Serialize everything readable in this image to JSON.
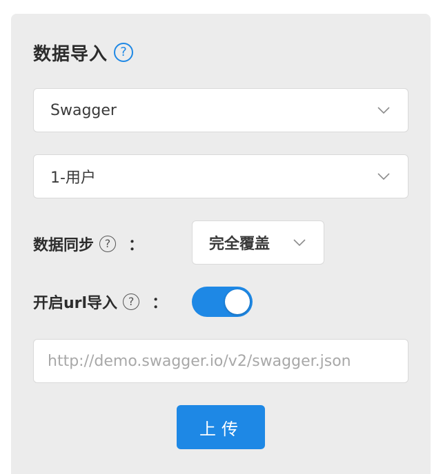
{
  "import": {
    "title": "数据导入",
    "title_help_icon": "question-circle-icon",
    "source_select": {
      "value": "Swagger"
    },
    "project_select": {
      "value": "1-用户"
    },
    "sync": {
      "label": "数据同步",
      "colon": "：",
      "help_icon": "question-circle-icon",
      "value": "完全覆盖"
    },
    "url_import": {
      "label": "开启url导入",
      "colon": "：",
      "help_icon": "question-circle-icon",
      "enabled": true
    },
    "url_input": {
      "value": "",
      "placeholder": "http://demo.swagger.io/v2/swagger.json"
    },
    "upload_button": "上传"
  },
  "colors": {
    "accent": "#1e88e5",
    "panel_background": "#ececec",
    "border": "#d9d9d9"
  }
}
